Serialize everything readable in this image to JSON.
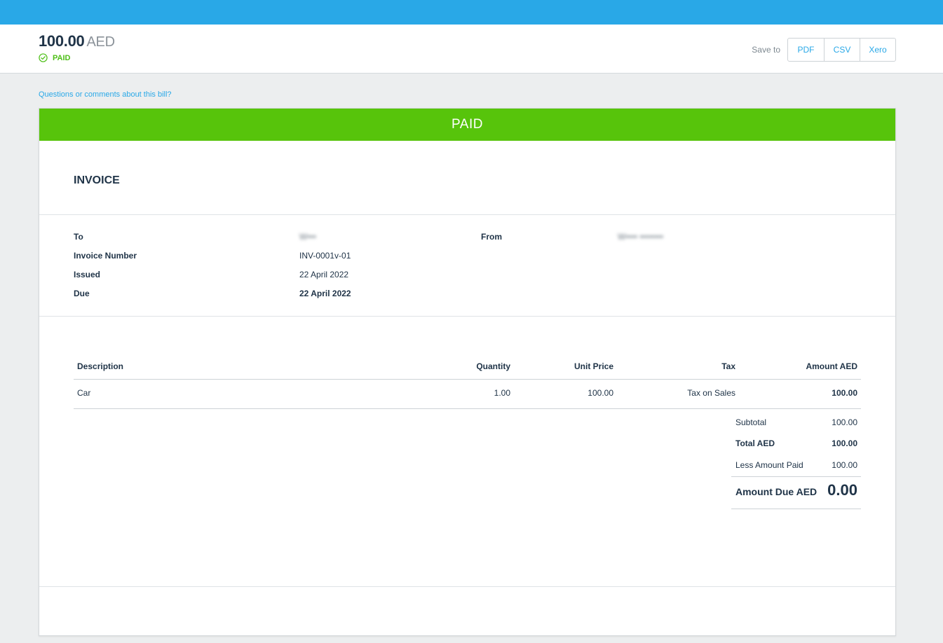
{
  "header": {
    "amount": "100.00",
    "currency": "AED",
    "status": "PAID",
    "save_to_label": "Save to",
    "save_buttons": [
      "PDF",
      "CSV",
      "Xero"
    ]
  },
  "questions_link": "Questions or comments about this bill?",
  "banner": "PAID",
  "invoice": {
    "title": "INVOICE",
    "to_label": "To",
    "to_value": "W•••",
    "from_label": "From",
    "from_value": "W•••• ••••••••",
    "number_label": "Invoice Number",
    "number_value": "INV-0001v-01",
    "issued_label": "Issued",
    "issued_value": "22 April 2022",
    "due_label": "Due",
    "due_value": "22 April 2022"
  },
  "table": {
    "headers": [
      "Description",
      "Quantity",
      "Unit Price",
      "Tax",
      "Amount AED"
    ],
    "rows": [
      [
        "Car",
        "1.00",
        "100.00",
        "Tax on Sales",
        "100.00"
      ]
    ]
  },
  "totals": {
    "subtotal_label": "Subtotal",
    "subtotal_value": "100.00",
    "total_label": "Total AED",
    "total_value": "100.00",
    "paid_label": "Less Amount Paid",
    "paid_value": "100.00",
    "due_label": "Amount Due AED",
    "due_value": "0.00"
  },
  "colors": {
    "topbar": "#29a8e7",
    "paid_green": "#57c40b",
    "status_green": "#4dbf16",
    "link_blue": "#29a8e7",
    "text_dark": "#203448"
  }
}
